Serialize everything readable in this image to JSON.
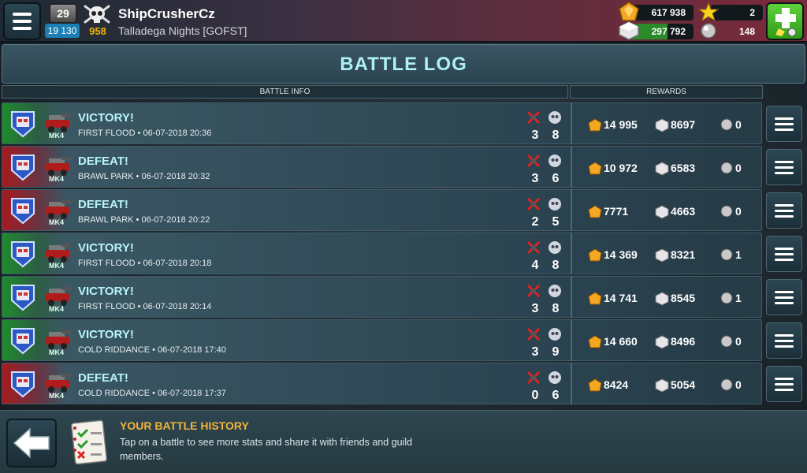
{
  "player": {
    "level": "29",
    "xp": "19 130",
    "skull_count": "958",
    "name": "ShipCrusherCz",
    "team": "Talladega Nights [GOFST]"
  },
  "resources": {
    "gold": "617 938",
    "stars": "2",
    "crystals": "297 792",
    "pearls": "148"
  },
  "page": {
    "title": "BATTLE LOG",
    "col_battle_info": "BATTLE INFO",
    "col_rewards": "REWARDS"
  },
  "battles": [
    {
      "result": "VICTORY!",
      "details": "FIRST FLOOD • 06-07-2018 20:36",
      "mk": "MK4",
      "kills": "3",
      "deaths": "8",
      "gold": "14 995",
      "crystals": "8697",
      "pearls": "0"
    },
    {
      "result": "DEFEAT!",
      "details": "BRAWL PARK • 06-07-2018 20:32",
      "mk": "MK4",
      "kills": "3",
      "deaths": "6",
      "gold": "10 972",
      "crystals": "6583",
      "pearls": "0"
    },
    {
      "result": "DEFEAT!",
      "details": "BRAWL PARK • 06-07-2018 20:22",
      "mk": "MK4",
      "kills": "2",
      "deaths": "5",
      "gold": "7771",
      "crystals": "4663",
      "pearls": "0"
    },
    {
      "result": "VICTORY!",
      "details": "FIRST FLOOD • 06-07-2018 20:18",
      "mk": "MK4",
      "kills": "4",
      "deaths": "8",
      "gold": "14 369",
      "crystals": "8321",
      "pearls": "1"
    },
    {
      "result": "VICTORY!",
      "details": "FIRST FLOOD • 06-07-2018 20:14",
      "mk": "MK4",
      "kills": "3",
      "deaths": "8",
      "gold": "14 741",
      "crystals": "8545",
      "pearls": "1"
    },
    {
      "result": "VICTORY!",
      "details": "COLD RIDDANCE • 06-07-2018 17:40",
      "mk": "MK4",
      "kills": "3",
      "deaths": "9",
      "gold": "14 660",
      "crystals": "8496",
      "pearls": "0"
    },
    {
      "result": "DEFEAT!",
      "details": "COLD RIDDANCE • 06-07-2018 17:37",
      "mk": "MK4",
      "kills": "0",
      "deaths": "6",
      "gold": "8424",
      "crystals": "5054",
      "pearls": "0"
    }
  ],
  "footer": {
    "title": "YOUR BATTLE HISTORY",
    "text": "Tap on a battle to see more stats and share it with friends and guild members."
  },
  "colors": {
    "victory": "#1f8a2d",
    "defeat": "#a61b22",
    "title_text": "#aef0f6",
    "footer_title": "#f2b53a"
  },
  "icons": [
    "menu-icon",
    "skull-icon",
    "gold-gem-icon",
    "star-icon",
    "crystal-icon",
    "pearl-icon",
    "plus-icon",
    "shield-icon",
    "car-icon",
    "crossed-sword-icon",
    "skull-kill-icon",
    "back-arrow-icon",
    "checklist-icon"
  ]
}
